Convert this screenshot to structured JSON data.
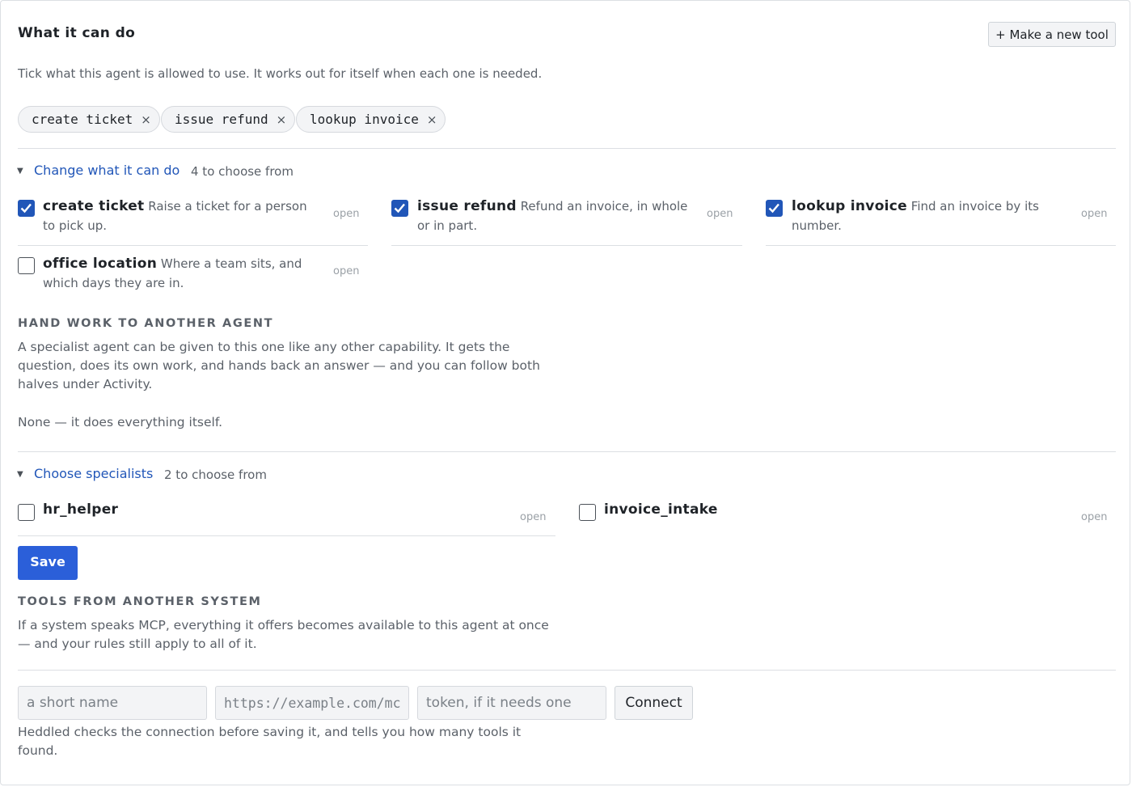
{
  "header": {
    "title": "What it can do",
    "new_tool_label": "+ Make a new tool"
  },
  "intro": "Tick what this agent is allowed to use. It works out for itself when each one is needed.",
  "selected_chips": [
    {
      "label": "create ticket",
      "remove": "×"
    },
    {
      "label": "issue refund",
      "remove": "×"
    },
    {
      "label": "lookup invoice",
      "remove": "×"
    }
  ],
  "tools_disclosure": {
    "link": "Change what it can do",
    "count": "4 to choose from"
  },
  "tool_options": [
    {
      "name": "create ticket",
      "desc": "Raise a ticket for a person to pick up.",
      "open": "open",
      "checked": true
    },
    {
      "name": "issue refund",
      "desc": "Refund an invoice, in whole or in part.",
      "open": "open",
      "checked": true
    },
    {
      "name": "lookup invoice",
      "desc": "Find an invoice by its number.",
      "open": "open",
      "checked": true
    },
    {
      "name": "office location",
      "desc": "Where a team sits, and which days they are in.",
      "open": "open",
      "checked": false
    }
  ],
  "handoff": {
    "heading": "HAND WORK TO ANOTHER AGENT",
    "description": "A specialist agent can be given to this one like any other capability. It gets the question, does its own work, and hands back an answer — and you can follow both halves under Activity.",
    "none_note": "None — it does everything itself."
  },
  "specialists_disclosure": {
    "link": "Choose specialists",
    "count": "2 to choose from"
  },
  "specialist_options": [
    {
      "name": "hr_helper",
      "open": "open",
      "checked": false
    },
    {
      "name": "invoice_intake",
      "open": "open",
      "checked": false
    }
  ],
  "save_label": "Save",
  "mcp": {
    "heading": "TOOLS FROM ANOTHER SYSTEM",
    "description": "If a system speaks MCP, everything it offers becomes available to this agent at once — and your rules still apply to all of it.",
    "name_placeholder": "a short name",
    "url_placeholder": "https://example.com/mcp",
    "token_placeholder": "token, if it needs one",
    "connect_label": "Connect",
    "help": "Heddled checks the connection before saving it, and tells you how many tools it found."
  },
  "colors": {
    "accent": "#2156b8",
    "primary_button": "#2b5fd9",
    "muted_text": "#5b6169"
  }
}
